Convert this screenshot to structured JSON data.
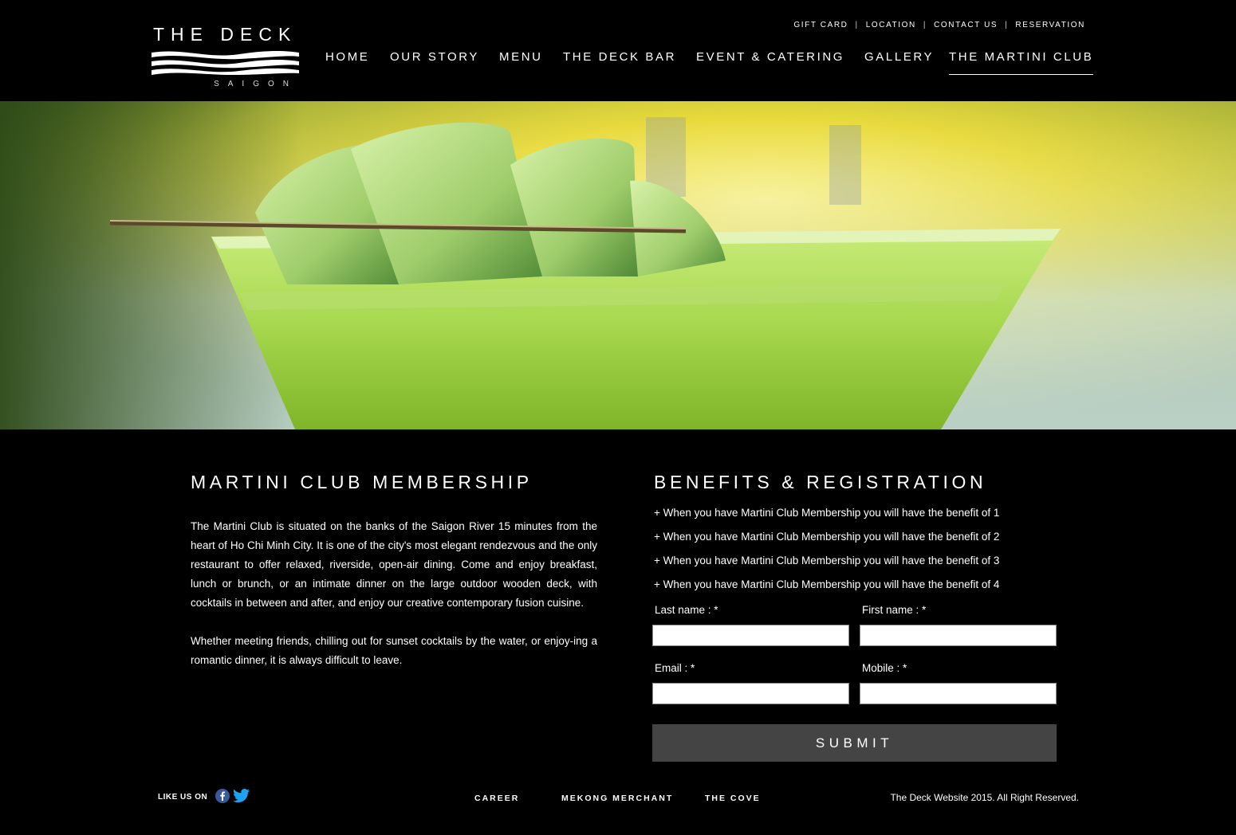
{
  "brand": {
    "title": "THE DECK",
    "subtitle": "SAIGON"
  },
  "top_nav": {
    "items": [
      "GIFT CARD",
      "LOCATION",
      "CONTACT US",
      "RESERVATION"
    ],
    "separator": "|"
  },
  "main_nav": {
    "items": [
      "HOME",
      "OUR STORY",
      "MENU",
      "THE DECK BAR",
      "EVENT & CATERING",
      "GALLERY",
      "THE MARTINI CLUB"
    ],
    "active": "THE MARTINI CLUB"
  },
  "hero": {
    "icon": "martini-photo"
  },
  "membership": {
    "title": "MARTINI CLUB MEMBERSHIP",
    "paragraphs": [
      "The Martini Club is situated on the banks of the Saigon River 15 minutes from the heart of Ho Chi Minh City. It is one of the city's most elegant rendezvous and the only restaurant to offer relaxed, riverside, open-air dining. Come and enjoy breakfast, lunch or brunch, or an intimate dinner on the large outdoor wooden deck, with cocktails in between and after, and enjoy our creative contemporary fusion cuisine.",
      "Whether meeting friends, chilling out for sunset cocktails by the water, or enjoy-ing a romantic dinner, it is always difficult to leave."
    ]
  },
  "registration": {
    "title": "BENEFITS & REGISTRATION",
    "benefits": [
      "+ When you have Martini Club Membership you will have the benefit of 1",
      "+ When you have Martini Club Membership you will have the benefit of 2",
      "+ When you have Martini Club Membership you will have the benefit of 3",
      "+ When you have Martini Club Membership you will have the benefit of 4"
    ],
    "fields": {
      "last_name": {
        "label": "Last name : *",
        "value": ""
      },
      "first_name": {
        "label": "First name : *",
        "value": ""
      },
      "email": {
        "label": "Email : *",
        "value": ""
      },
      "mobile": {
        "label": "Mobile : *",
        "value": ""
      }
    },
    "submit_label": "SUBMIT"
  },
  "footer": {
    "like_us": "LIKE US ON",
    "social_icons": [
      "facebook-icon",
      "twitter-icon"
    ],
    "links": [
      "CAREER",
      "MEKONG MERCHANT",
      "THE COVE"
    ],
    "copyright": "The Deck Website 2015. All Right Reserved."
  },
  "colors": {
    "background": "#000000",
    "text": "#ffffff",
    "submit_bg": "#444444",
    "facebook": "#3b5998",
    "twitter": "#1da1f2"
  }
}
